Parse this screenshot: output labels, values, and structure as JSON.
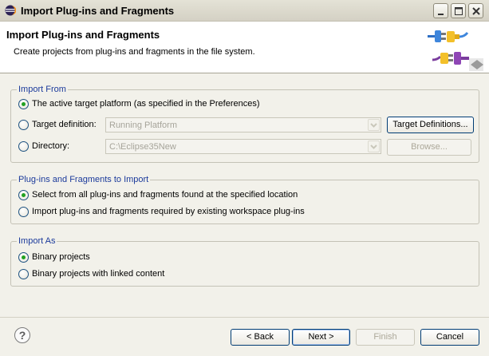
{
  "window": {
    "title": "Import Plug-ins and Fragments"
  },
  "banner": {
    "title": "Import Plug-ins and Fragments",
    "description": "Create projects from plug-ins and fragments in the file system.",
    "icon": "plug-connectors-icon"
  },
  "import_from": {
    "group_label": "Import From",
    "options": [
      {
        "label": "The active target platform (as specified in the Preferences)",
        "selected": true
      },
      {
        "label": "Target definition:",
        "selected": false
      },
      {
        "label": "Directory:",
        "selected": false
      }
    ],
    "target_definition_value": "Running Platform",
    "directory_value": "C:\\Eclipse35New",
    "target_definitions_button": "Target Definitions...",
    "browse_button": "Browse..."
  },
  "to_import": {
    "group_label": "Plug-ins and Fragments to Import",
    "options": [
      {
        "label": "Select from all plug-ins and fragments found at the specified location",
        "selected": true
      },
      {
        "label": "Import plug-ins and fragments required by existing workspace plug-ins",
        "selected": false
      }
    ]
  },
  "import_as": {
    "group_label": "Import As",
    "options": [
      {
        "label": "Binary projects",
        "selected": true
      },
      {
        "label": "Binary projects with linked content",
        "selected": false
      }
    ]
  },
  "footer": {
    "help_glyph": "?",
    "back": "< Back",
    "next": "Next >",
    "finish": "Finish",
    "cancel": "Cancel"
  },
  "colors": {
    "group_title": "#1b3a9b",
    "radio_selected": "#21a121"
  }
}
